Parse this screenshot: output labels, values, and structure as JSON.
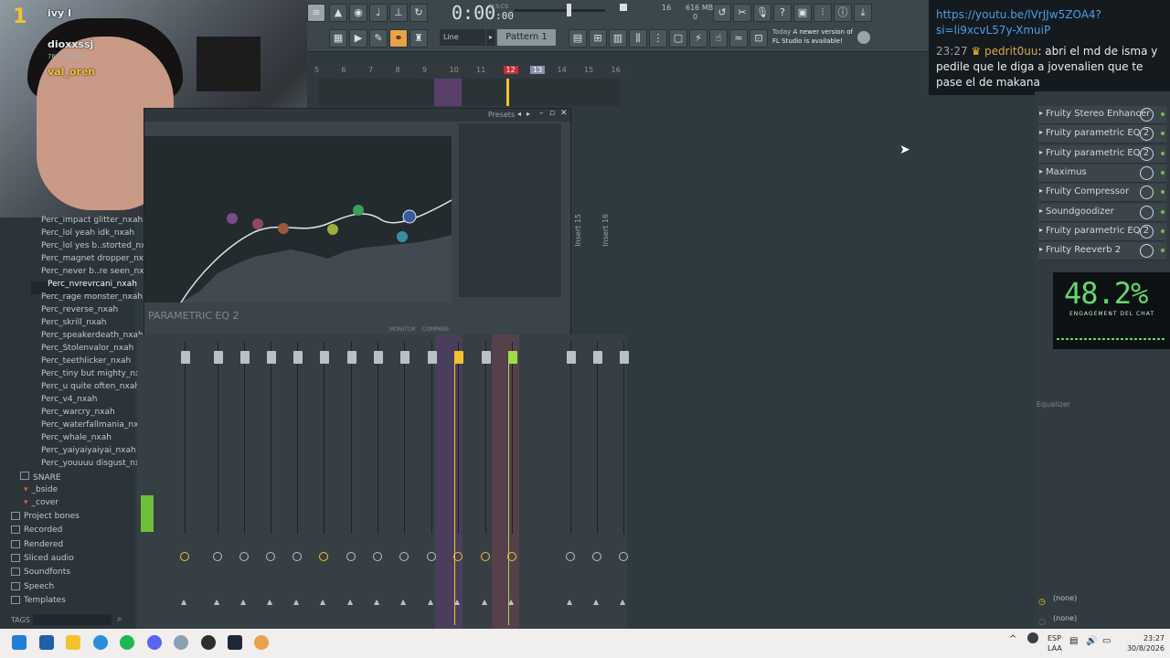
{
  "chat_overlay": {
    "user1": "ivy I",
    "user2": "dioxxssj",
    "user2_sub": "76 mensajes",
    "user3": "val_oren",
    "rank": "1"
  },
  "toolbar": {
    "time": "0:00",
    "time_sub": ":00",
    "time_unit": "M:S:CS",
    "snap": "Line",
    "pattern": "Pattern 1",
    "cpu": "16",
    "mem": "616 MB",
    "poly": "0",
    "news_line1": "Today",
    "news_line2": "A newer version of",
    "news_line3": "FL Studio is available!"
  },
  "ruler": [
    "5",
    "6",
    "7",
    "8",
    "9",
    "10",
    "11",
    "12",
    "13",
    "14",
    "15",
    "16"
  ],
  "browser": {
    "items": [
      "Perc_impact glitter_nxah",
      "Perc_lol yeah idk_nxah",
      "Perc_lol yes b..storted_nxah",
      "Perc_magnet dropper_nxah",
      "Perc_never b..re seen_nxah",
      "Perc_nvrevrcani_nxah",
      "Perc_rage monster_nxah",
      "Perc_reverse_nxah",
      "Perc_skrill_nxah",
      "Perc_speakerdeath_nxah",
      "Perc_Stolenvalor_nxah",
      "Perc_teethlicker_nxah",
      "Perc_tiny but mighty_nxah",
      "Perc_u quite often_nxah",
      "Perc_v4_nxah",
      "Perc_warcry_nxah",
      "Perc_waterfallmania_nxah",
      "Perc_whale_nxah",
      "Perc_yaiyaiyaiyai_nxah",
      "Perc_youuuu disgust_nxah"
    ],
    "snare": "SNARE",
    "bside": "_bside",
    "cover": "_cover",
    "folders": [
      "Project bones",
      "Recorded",
      "Rendered",
      "Sliced audio",
      "Soundfonts",
      "Speech",
      "Templates"
    ],
    "tags": "TAGS"
  },
  "eq": {
    "title": "PARAMETRIC EQ 2",
    "presets": "Presets",
    "monitor": "MONITOR",
    "compare": "COMPARE"
  },
  "mixer": {
    "insert15": "Insert 15",
    "insert16": "Insert 16"
  },
  "rack": {
    "slots": [
      "Fruity Stereo Enhancer",
      "Fruity parametric EQ 2",
      "Fruity parametric EQ 2",
      "Maximus",
      "Fruity Compressor",
      "Soundgoodizer",
      "Fruity parametric EQ 2",
      "Fruity Reeverb 2"
    ],
    "equalizer": "Equalizer",
    "none1": "(none)",
    "none2": "(none)"
  },
  "engagement": {
    "value": "48.2%",
    "label": "ENGAGEMENT DEL CHAT"
  },
  "chat": {
    "link": "https://youtu.be/lVrJJw5ZOA4?si=li9xcvL57y-XmuiP",
    "time": "23:27",
    "user": "pedrit0uu",
    "message": ": abri el md de isma y pedile que le diga a jovenalien que te pase el de makana"
  },
  "taskbar": {
    "lang1": "ESP",
    "lang2": "LAA",
    "time": "23:27",
    "date": "30/8/2026"
  },
  "colors": {
    "accent_yellow": "#f3c32b",
    "accent_green": "#6ec03b",
    "engagement_green": "#63d96b",
    "chat_link": "#4a9fe8",
    "active_marker": "#e03a3a"
  }
}
